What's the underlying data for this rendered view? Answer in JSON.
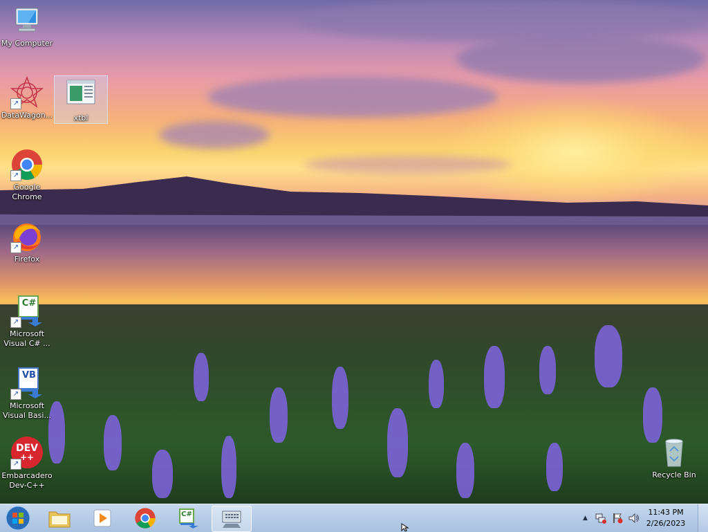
{
  "desktop": {
    "icons": [
      {
        "label": "My Computer",
        "icon": "computer-icon"
      },
      {
        "label": "DataWagon...",
        "icon": "datawagon-icon"
      },
      {
        "label": "xtbl",
        "icon": "xtbl-icon"
      },
      {
        "label": "Google Chrome",
        "icon": "chrome-icon"
      },
      {
        "label": "Firefox",
        "icon": "firefox-icon"
      },
      {
        "label": "Microsoft Visual C# ...",
        "icon": "visual-csharp-icon"
      },
      {
        "label": "Microsoft Visual Basi...",
        "icon": "visual-basic-icon"
      },
      {
        "label": "Embarcadero Dev-C++",
        "icon": "devcpp-icon"
      },
      {
        "label": "Recycle Bin",
        "icon": "recycle-bin-icon"
      }
    ],
    "icon_texts": {
      "csharp": "C#",
      "vb": "VB",
      "dev_line1": "DEV",
      "dev_line2": "++",
      "shortcut_arrow": "↗"
    }
  },
  "taskbar": {
    "items": [
      {
        "name": "file-explorer",
        "icon": "folder-icon"
      },
      {
        "name": "media-player",
        "icon": "media-player-icon"
      },
      {
        "name": "chrome",
        "icon": "chrome-icon"
      },
      {
        "name": "visual-csharp",
        "icon": "visual-csharp-icon"
      },
      {
        "name": "on-screen-keyboard",
        "icon": "keyboard-icon",
        "active": true
      }
    ],
    "tray": {
      "show_hidden": "▲",
      "time": "11:43 PM",
      "date": "2/26/2023"
    }
  },
  "colors": {
    "taskbar": "#b7cde7",
    "selection": "#c8dcff"
  }
}
